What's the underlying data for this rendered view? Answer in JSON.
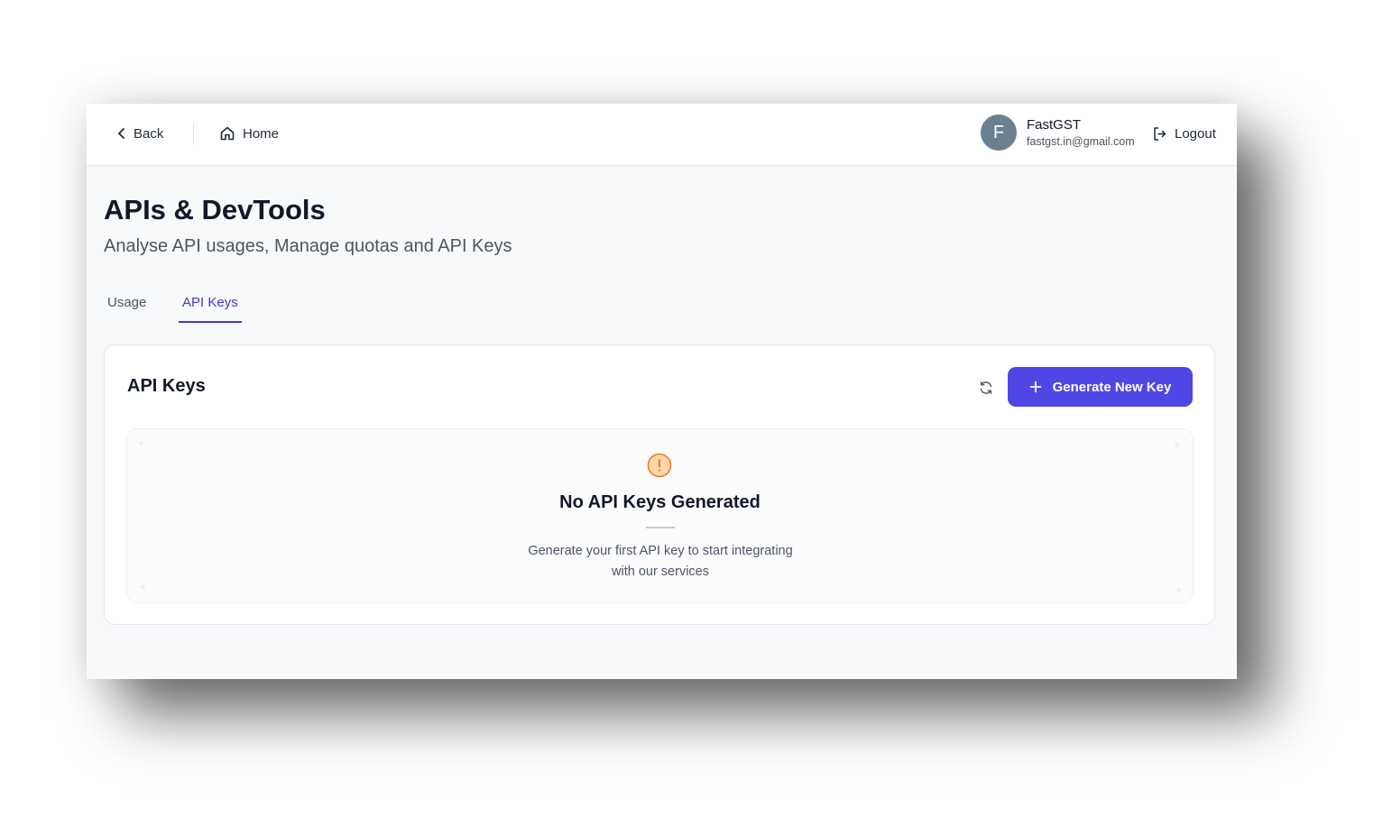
{
  "nav": {
    "back_label": "Back",
    "home_label": "Home",
    "logout_label": "Logout",
    "icons": [
      "chevron-left-icon",
      "home-icon",
      "logout-icon"
    ]
  },
  "user": {
    "avatar_initial": "F",
    "name": "FastGST",
    "email": "fastgst.in@gmail.com",
    "avatar_color": "#6b8091"
  },
  "page": {
    "title": "APIs & DevTools",
    "subtitle": "Analyse API usages, Manage quotas and API Keys"
  },
  "tabs": [
    {
      "label": "Usage",
      "active": false
    },
    {
      "label": "API Keys",
      "active": true
    }
  ],
  "api_keys_card": {
    "title": "API Keys",
    "generate_label": "Generate New Key",
    "refresh_icon": "refresh-icon",
    "empty_state": {
      "icon": "warning-icon",
      "title": "No API Keys Generated",
      "description": "Generate your first API key to start integrating with our services"
    }
  },
  "colors": {
    "accent": "#4f46e5",
    "active_tab": "#4338ca",
    "warning": "#f97316",
    "warning_bg": "#fed7aa"
  }
}
